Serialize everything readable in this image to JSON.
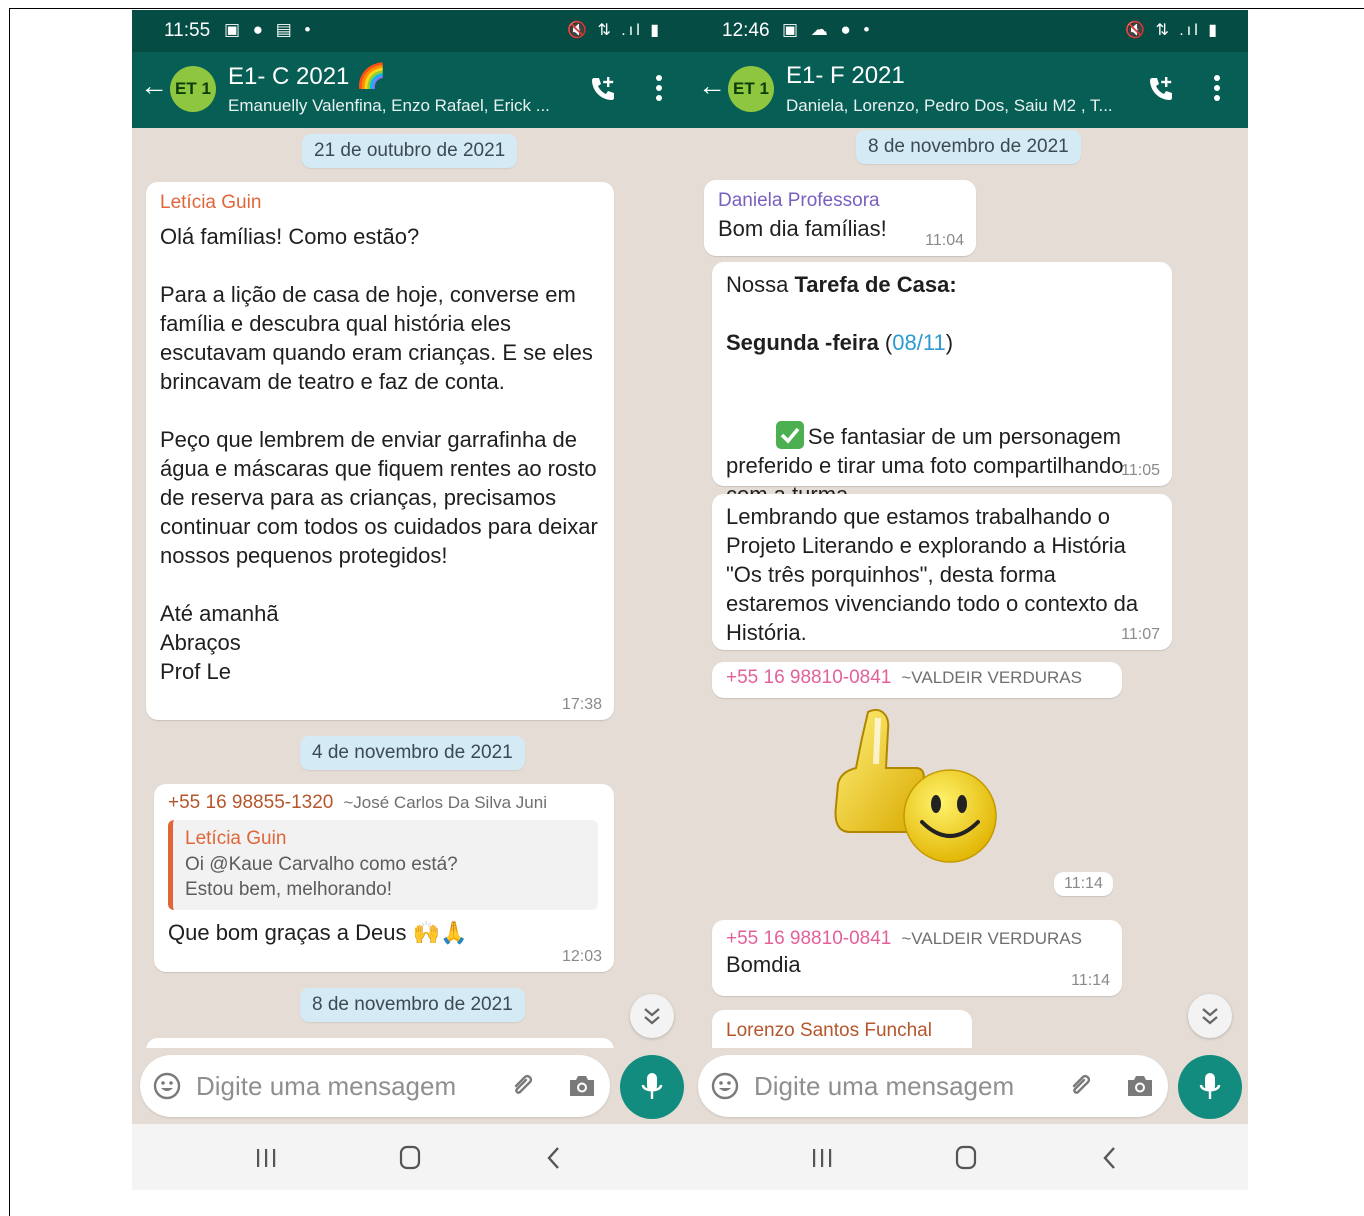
{
  "left": {
    "status_time": "11:55",
    "chat_title": "E1- C 2021",
    "title_emoji": "🌈",
    "avatar_text": "ET 1",
    "members": "Emanuelly Valenfina, Enzo Rafael, Erick ...",
    "date1": "21 de outubro de 2021",
    "msg1": {
      "sender": "Letícia Guin",
      "text": "Olá famílias! Como estão?\n\nPara a lição de casa de hoje, converse em família e descubra qual história eles escutavam quando eram crianças. E se eles brincavam de teatro e faz de conta.\n\nPeço que lembrem de enviar garrafinha de água e máscaras que fiquem rentes ao rosto de reserva para as crianças, precisamos continuar com todos os cuidados para deixar nossos pequenos protegidos!\n\nAté amanhã\nAbraços\nProf Le",
      "time": "17:38"
    },
    "date2": "4 de novembro de 2021",
    "msg2": {
      "phone": "+55 16 98855-1320",
      "push_name": "~José Carlos Da Silva Juni",
      "quote_sender": "Letícia Guin",
      "quote_text": "Oi @Kaue Carvalho como está?\nEstou bem, melhorando!",
      "text": "Que bom graças a Deus 🙌🙏",
      "time": "12:03"
    },
    "date3": "8 de novembro de 2021",
    "input_placeholder": "Digite uma mensagem"
  },
  "right": {
    "status_time": "12:46",
    "chat_title": "E1- F 2021",
    "avatar_text": "ET 1",
    "members": "Daniela, Lorenzo, Pedro Dos, Saiu M2 , T...",
    "date1": "8 de novembro de 2021",
    "msg1": {
      "sender": "Daniela Professora",
      "text": "Bom dia famílias!",
      "time": "11:04"
    },
    "msg2": {
      "line1_plain": "Nossa ",
      "line1_bold": "Tarefa de Casa:",
      "line2_bold": "Segunda -feira",
      "line2_open": " (",
      "line2_link": "08/11",
      "line2_close": ")",
      "task": "Se fantasiar de um personagem preferido e tirar uma foto compartilhando com a turma.",
      "time": "11:05"
    },
    "msg3": {
      "text": "Lembrando que estamos trabalhando o Projeto Literando e explorando a História \"Os três porquinhos\", desta forma estaremos vivenciando todo o contexto da História.",
      "time": "11:07"
    },
    "sticker_header": {
      "phone": "+55 16 98810-0841",
      "push_name": "~VALDEIR VERDURAS"
    },
    "sticker_time": "11:14",
    "msg4": {
      "phone": "+55 16 98810-0841",
      "push_name": "~VALDEIR VERDURAS",
      "text": "Bomdia",
      "time": "11:14"
    },
    "msg5_sender": "Lorenzo Santos Funchal",
    "input_placeholder": "Digite uma mensagem"
  },
  "colors": {
    "appbar": "#075e54",
    "statusbar": "#054d44",
    "accent_green": "#128c7e",
    "chat_bg": "#e5ddd5",
    "date_chip": "#d4eaf4"
  },
  "icons": [
    "back-arrow-icon",
    "group-avatar",
    "add-call-icon",
    "more-vert-icon",
    "emoji-icon",
    "attach-icon",
    "camera-icon",
    "mic-icon",
    "scroll-down-icon",
    "recent-apps-icon",
    "home-icon",
    "back-icon",
    "check-mark-icon",
    "thumbs-up-smiley-sticker"
  ]
}
